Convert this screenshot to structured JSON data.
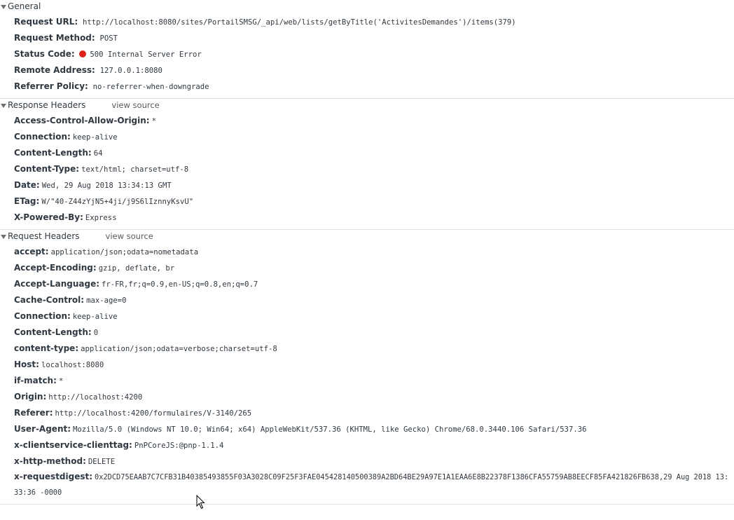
{
  "general": {
    "title": "General",
    "request_url_label": "Request URL:",
    "request_url": "http://localhost:8080/sites/PortailSMSG/_api/web/lists/getByTitle('ActivitesDemandes')/items(379)",
    "request_method_label": "Request Method:",
    "request_method": "POST",
    "status_code_label": "Status Code:",
    "status_code": "500 Internal Server Error",
    "status_color": "#e0201b",
    "remote_address_label": "Remote Address:",
    "remote_address": "127.0.0.1:8080",
    "referrer_policy_label": "Referrer Policy:",
    "referrer_policy": "no-referrer-when-downgrade"
  },
  "response_headers": {
    "title": "Response Headers",
    "view_source": "view source",
    "items": [
      {
        "name": "Access-Control-Allow-Origin:",
        "value": "*"
      },
      {
        "name": "Connection:",
        "value": "keep-alive"
      },
      {
        "name": "Content-Length:",
        "value": "64"
      },
      {
        "name": "Content-Type:",
        "value": "text/html; charset=utf-8"
      },
      {
        "name": "Date:",
        "value": "Wed, 29 Aug 2018 13:34:13 GMT"
      },
      {
        "name": "ETag:",
        "value": "W/\"40-Z44zYjN5+4ji/j9S6lIznnyKsvU\""
      },
      {
        "name": "X-Powered-By:",
        "value": "Express"
      }
    ]
  },
  "request_headers": {
    "title": "Request Headers",
    "view_source": "view source",
    "items": [
      {
        "name": "accept:",
        "value": "application/json;odata=nometadata"
      },
      {
        "name": "Accept-Encoding:",
        "value": "gzip, deflate, br"
      },
      {
        "name": "Accept-Language:",
        "value": "fr-FR,fr;q=0.9,en-US;q=0.8,en;q=0.7"
      },
      {
        "name": "Cache-Control:",
        "value": "max-age=0"
      },
      {
        "name": "Connection:",
        "value": "keep-alive"
      },
      {
        "name": "Content-Length:",
        "value": "0"
      },
      {
        "name": "content-type:",
        "value": "application/json;odata=verbose;charset=utf-8"
      },
      {
        "name": "Host:",
        "value": "localhost:8080"
      },
      {
        "name": "if-match:",
        "value": "*"
      },
      {
        "name": "Origin:",
        "value": "http://localhost:4200"
      },
      {
        "name": "Referer:",
        "value": "http://localhost:4200/formulaires/V-3140/265"
      },
      {
        "name": "User-Agent:",
        "value": "Mozilla/5.0 (Windows NT 10.0; Win64; x64) AppleWebKit/537.36 (KHTML, like Gecko) Chrome/68.0.3440.106 Safari/537.36"
      },
      {
        "name": "x-clientservice-clienttag:",
        "value": "PnPCoreJS:@pnp-1.1.4"
      },
      {
        "name": "x-http-method:",
        "value": "DELETE"
      },
      {
        "name": "x-requestdigest:",
        "value": "0x2DCD75EAAB7C7CFB31B40385493855F03A3028C09F25F3FAE045428140500389A2BD64BE29A97E1A1EAA6E8B22378F1386CFA55759AB8EECF85FA421826FB638,29 Aug 2018 13:33:36 -0000"
      }
    ]
  },
  "icons": {
    "expand": "triangle-down-icon",
    "status": "status-dot-icon",
    "cursor": "mouse-pointer-icon"
  }
}
